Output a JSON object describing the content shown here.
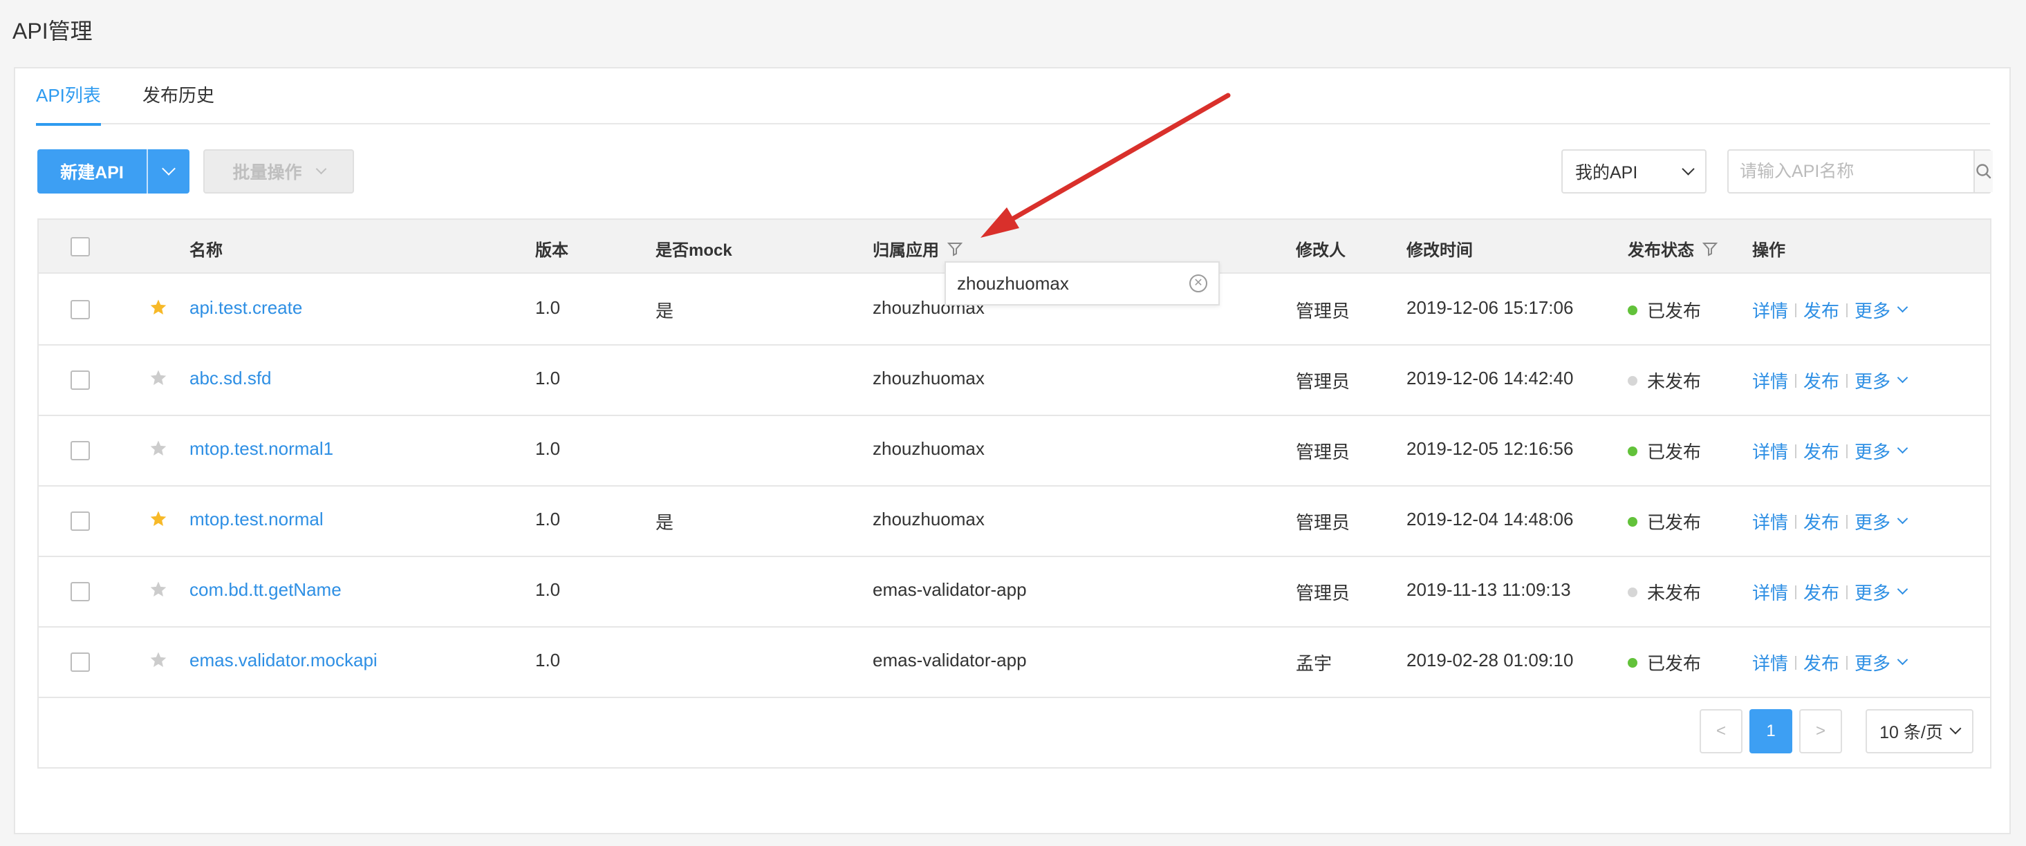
{
  "page_title": "API管理",
  "tabs": [
    {
      "label": "API列表",
      "active": true
    },
    {
      "label": "发布历史",
      "active": false
    }
  ],
  "toolbar": {
    "new_api_label": "新建API",
    "batch_label": "批量操作",
    "scope_value": "我的API",
    "search_placeholder": "请输入API名称"
  },
  "table": {
    "columns": {
      "name": "名称",
      "version": "版本",
      "mock": "是否mock",
      "app": "归属应用",
      "modifier": "修改人",
      "modified_time": "修改时间",
      "status": "发布状态",
      "actions": "操作"
    },
    "rows": [
      {
        "starred": true,
        "name": "api.test.create",
        "version": "1.0",
        "mock": "是",
        "app": "zhouzhuomax",
        "modifier": "管理员",
        "time": "2019-12-06 15:17:06",
        "status": "已发布",
        "published": true
      },
      {
        "starred": false,
        "name": "abc.sd.sfd",
        "version": "1.0",
        "mock": "",
        "app": "zhouzhuomax",
        "modifier": "管理员",
        "time": "2019-12-06 14:42:40",
        "status": "未发布",
        "published": false
      },
      {
        "starred": false,
        "name": "mtop.test.normal1",
        "version": "1.0",
        "mock": "",
        "app": "zhouzhuomax",
        "modifier": "管理员",
        "time": "2019-12-05 12:16:56",
        "status": "已发布",
        "published": true
      },
      {
        "starred": true,
        "name": "mtop.test.normal",
        "version": "1.0",
        "mock": "是",
        "app": "zhouzhuomax",
        "modifier": "管理员",
        "time": "2019-12-04 14:48:06",
        "status": "已发布",
        "published": true
      },
      {
        "starred": false,
        "name": "com.bd.tt.getName",
        "version": "1.0",
        "mock": "",
        "app": "emas-validator-app",
        "modifier": "管理员",
        "time": "2019-11-13 11:09:13",
        "status": "未发布",
        "published": false
      },
      {
        "starred": false,
        "name": "emas.validator.mockapi",
        "version": "1.0",
        "mock": "",
        "app": "emas-validator-app",
        "modifier": "孟宇",
        "time": "2019-02-28 01:09:10",
        "status": "已发布",
        "published": true
      }
    ],
    "actions": {
      "detail": "详情",
      "publish": "发布",
      "more": "更多"
    }
  },
  "filter_popup": {
    "value": "zhouzhuomax"
  },
  "pagination": {
    "current": "1",
    "prev": "<",
    "next": ">",
    "page_size": "10 条/页"
  },
  "colors": {
    "accent": "#3d9ff3",
    "link": "#2e8fe4",
    "published": "#62c23a",
    "unpublished": "#d6d6d6",
    "star_on": "#f7b928",
    "star_off": "#cccccc",
    "arrow": "#d9302b"
  },
  "icons": [
    "chevron-down-icon",
    "search-icon",
    "filter-icon",
    "star-icon",
    "clear-icon",
    "chevron-left-icon",
    "chevron-right-icon"
  ]
}
